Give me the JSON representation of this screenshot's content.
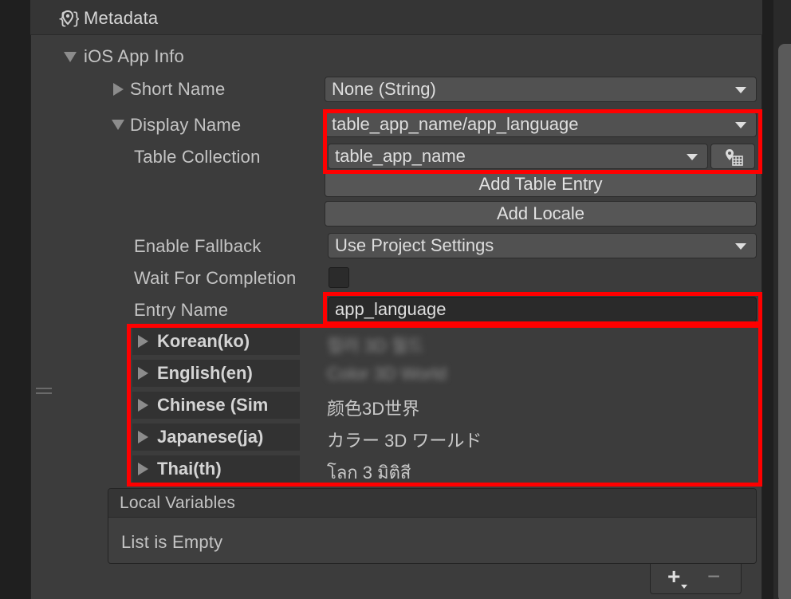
{
  "header": {
    "title": "Metadata",
    "icon": "metadata-icon"
  },
  "ios_app_info": {
    "label": "iOS App Info",
    "short_name": {
      "label": "Short Name",
      "value": "None (String)"
    },
    "display_name": {
      "label": "Display Name",
      "value": "table_app_name/app_language"
    },
    "table_collection": {
      "label": "Table Collection",
      "value": "table_app_name",
      "button_icon": "table-locate-icon"
    },
    "add_table_entry_label": "Add Table Entry",
    "add_locale_label": "Add Locale",
    "enable_fallback": {
      "label": "Enable Fallback",
      "value": "Use Project Settings"
    },
    "wait_for_completion": {
      "label": "Wait For Completion",
      "checked": false
    },
    "entry_name": {
      "label": "Entry Name",
      "value": "app_language"
    },
    "locales": [
      {
        "name": "Korean(ko)",
        "value": "컬러 3D 월드",
        "blurred": true
      },
      {
        "name": "English(en)",
        "value": "Color 3D World",
        "blurred": true
      },
      {
        "name": "Chinese (Sim",
        "value": "颜色3D世界",
        "blurred": false
      },
      {
        "name": "Japanese(ja)",
        "value": "カラー 3D ワールド",
        "blurred": false
      },
      {
        "name": "Thai(th)",
        "value": "โลก 3 มิติสี",
        "blurred": false
      }
    ]
  },
  "local_variables": {
    "title": "Local Variables",
    "empty_text": "List is Empty",
    "add_symbol": "+",
    "remove_symbol": "−"
  },
  "colors": {
    "highlight": "#ff0000",
    "panel": "#3c3c3c",
    "field": "#515151"
  }
}
